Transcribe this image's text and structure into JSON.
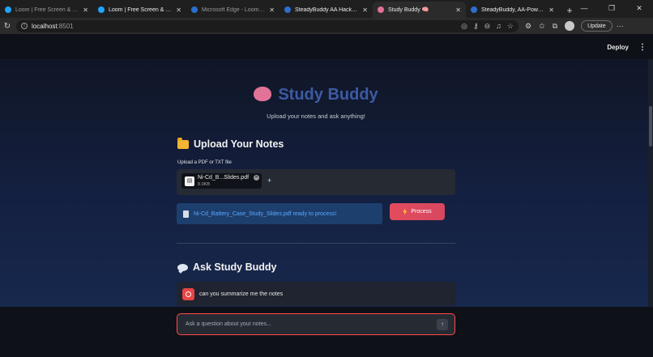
{
  "browser": {
    "tabs": [
      {
        "title": "Loom | Free Screen & Video R",
        "icon": "loom-icon",
        "state": "normal"
      },
      {
        "title": "Loom | Free Screen & Video R",
        "icon": "loom-icon",
        "state": "bright"
      },
      {
        "title": "Microsoft Edge - Loom | Free",
        "icon": "edge-icon",
        "state": "normal"
      },
      {
        "title": "SteadyBuddy AA HackFest Dc",
        "icon": "edge-icon",
        "state": "bright"
      },
      {
        "title": "Study Buddy 🧠",
        "icon": "brain-icon",
        "state": "active"
      },
      {
        "title": "SteadyBuddy, AA-Powered N",
        "icon": "edge-icon",
        "state": "bright"
      }
    ],
    "address": {
      "host": "localhost",
      "port": ":8501"
    },
    "update_label": "Update"
  },
  "header": {
    "deploy_label": "Deploy"
  },
  "app": {
    "title": "Study Buddy",
    "subtitle": "Upload your notes and ask anything!",
    "upload_section": {
      "heading": "Upload Your Notes",
      "uploader_label": "Upload a PDF or TXT file",
      "file": {
        "name": "Ni-Cd_B...Slides.pdf",
        "size": "8.0KB"
      }
    },
    "status_message": "Ni-Cd_Battery_Case_Study_Slides.pdf ready to process!",
    "process_label": "Process",
    "chat_section": {
      "heading": "Ask Study Buddy",
      "messages": [
        {
          "role": "user",
          "text": "can you summarize me the notes"
        }
      ]
    },
    "chat_input": {
      "placeholder": "Ask a question about your notes..."
    }
  },
  "colors": {
    "accent": "#ff4b4b",
    "title": "#3d5aa3",
    "info_text": "#5aa9ff",
    "background": "#0e1117"
  }
}
